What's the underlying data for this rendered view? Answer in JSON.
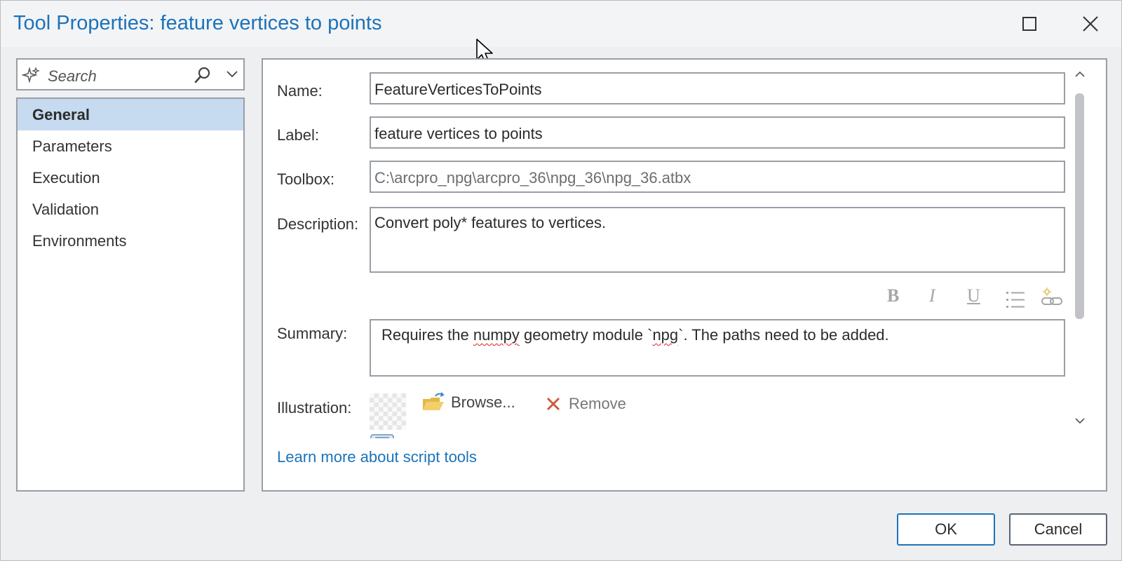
{
  "window": {
    "title": "Tool Properties: feature vertices to points"
  },
  "search": {
    "placeholder": "Search"
  },
  "nav": {
    "items": [
      {
        "label": "General",
        "active": true
      },
      {
        "label": "Parameters",
        "active": false
      },
      {
        "label": "Execution",
        "active": false
      },
      {
        "label": "Validation",
        "active": false
      },
      {
        "label": "Environments",
        "active": false
      }
    ]
  },
  "general": {
    "name_label": "Name:",
    "name_value": "FeatureVerticesToPoints",
    "label_label": "Label:",
    "label_value": "feature vertices to points",
    "toolbox_label": "Toolbox:",
    "toolbox_value": "C:\\arcpro_npg\\arcpro_36\\npg_36\\npg_36.atbx",
    "description_label": "Description:",
    "description_value": "Convert poly* features to vertices.",
    "format_toolbar": {
      "bold": "B",
      "italic": "I",
      "underline": "U"
    },
    "summary_label": "Summary:",
    "summary_parts": {
      "p1": "Requires the ",
      "w1": "numpy",
      "p2": " geometry module `",
      "w2": "npg",
      "p3": "`.  The paths need to be added."
    },
    "illustration_label": "Illustration:",
    "browse_label": "Browse...",
    "remove_label": "Remove",
    "learn_more": "Learn more about script tools"
  },
  "buttons": {
    "ok": "OK",
    "cancel": "Cancel"
  },
  "colors": {
    "accent": "#1c73b9",
    "nav_selected": "#c6dbef",
    "remove_icon": "#d05a3c",
    "folder_icon": "#e2b84a",
    "spellcheck": "#e02020"
  }
}
